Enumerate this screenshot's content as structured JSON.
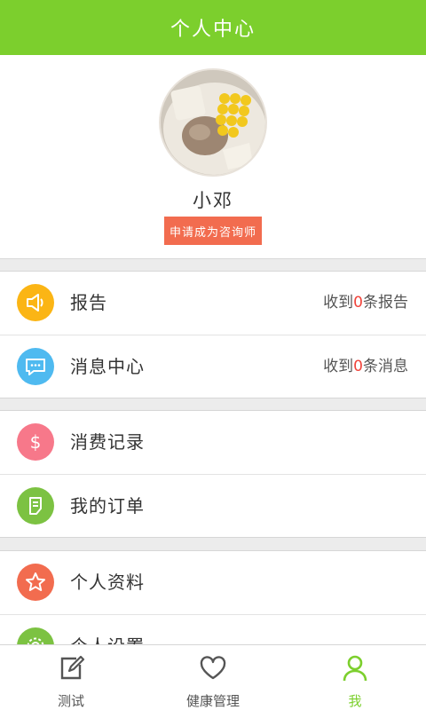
{
  "header": {
    "title": "个人中心"
  },
  "profile": {
    "username": "小邓",
    "apply_label": "申请成为咨询师"
  },
  "groups": [
    {
      "items": [
        {
          "label": "报告",
          "icon": "speaker-icon",
          "color": "#fbb515",
          "right_prefix": "收到",
          "right_count": "0",
          "right_suffix": "条报告"
        },
        {
          "label": "消息中心",
          "icon": "chat-icon",
          "color": "#4fbaf0",
          "right_prefix": "收到",
          "right_count": "0",
          "right_suffix": "条消息"
        }
      ]
    },
    {
      "items": [
        {
          "label": "消费记录",
          "icon": "dollar-icon",
          "color": "#f7788a"
        },
        {
          "label": "我的订单",
          "icon": "order-icon",
          "color": "#7cc242"
        }
      ]
    },
    {
      "items": [
        {
          "label": "个人资料",
          "icon": "star-icon",
          "color": "#f26c4f"
        },
        {
          "label": "个人设置",
          "icon": "gear-icon",
          "color": "#7cc242"
        }
      ]
    }
  ],
  "tabs": [
    {
      "label": "测试",
      "icon": "edit-icon"
    },
    {
      "label": "健康管理",
      "icon": "heart-icon"
    },
    {
      "label": "我",
      "icon": "person-icon",
      "active": true
    }
  ],
  "colors": {
    "brand": "#7ccf2d",
    "accent_red": "#f0433a",
    "apply_button": "#f26c4f"
  }
}
